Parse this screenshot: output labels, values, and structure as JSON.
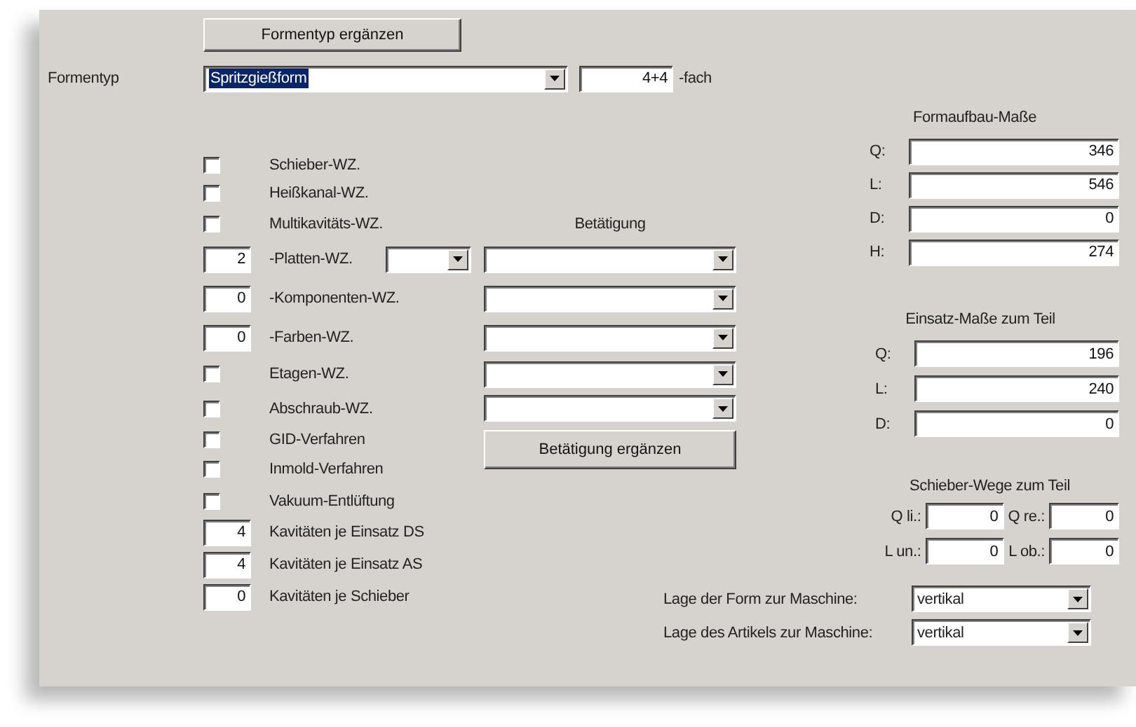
{
  "form_type_button": "Formentyp ergänzen",
  "form_type": {
    "label": "Formentyp",
    "value": "Spritzgießform",
    "highlighted": true,
    "multiplier": "4+4",
    "multiplier_suffix": "-fach"
  },
  "actuation_header": "Betätigung",
  "options": [
    {
      "kind": "checkbox",
      "label": "Schieber-WZ.",
      "checked": false,
      "actuation_select": false
    },
    {
      "kind": "checkbox",
      "label": "Heißkanal-WZ.",
      "checked": false,
      "actuation_select": false
    },
    {
      "kind": "checkbox",
      "label": "Multikavitäts-WZ.",
      "checked": false,
      "actuation_select": false
    },
    {
      "kind": "number_select",
      "value": "2",
      "label": "-Platten-WZ.",
      "actuation_select": true
    },
    {
      "kind": "number",
      "value": "0",
      "label": "-Komponenten-WZ.",
      "actuation_select": true
    },
    {
      "kind": "number",
      "value": "0",
      "label": "-Farben-WZ.",
      "actuation_select": true
    },
    {
      "kind": "checkbox",
      "label": "Etagen-WZ.",
      "checked": false,
      "actuation_select": true
    },
    {
      "kind": "checkbox",
      "label": "Abschraub-WZ.",
      "checked": false,
      "actuation_select": true
    },
    {
      "kind": "checkbox",
      "label": "GID-Verfahren",
      "checked": false,
      "actuation_select": false
    },
    {
      "kind": "checkbox",
      "label": "Inmold-Verfahren",
      "checked": false,
      "actuation_select": false
    },
    {
      "kind": "checkbox",
      "label": "Vakuum-Entlüftung",
      "checked": false,
      "actuation_select": false
    },
    {
      "kind": "number",
      "value": "4",
      "label": "Kavitäten je Einsatz DS",
      "actuation_select": false
    },
    {
      "kind": "number",
      "value": "4",
      "label": "Kavitäten je Einsatz AS",
      "actuation_select": false
    },
    {
      "kind": "number",
      "value": "0",
      "label": "Kavitäten je Schieber",
      "actuation_select": false
    }
  ],
  "actuation_button": "Betätigung ergänzen",
  "mold_dimensions": {
    "title": "Formaufbau-Maße",
    "fields": [
      {
        "label": "Q:",
        "value": "346"
      },
      {
        "label": "L:",
        "value": "546"
      },
      {
        "label": "D:",
        "value": "0"
      },
      {
        "label": "H:",
        "value": "274"
      }
    ]
  },
  "insert_dimensions": {
    "title": "Einsatz-Maße zum Teil",
    "fields": [
      {
        "label": "Q:",
        "value": "196"
      },
      {
        "label": "L:",
        "value": "240"
      },
      {
        "label": "D:",
        "value": "0"
      }
    ]
  },
  "slide_travel": {
    "title": "Schieber-Wege zum Teil",
    "fields": [
      {
        "label": "Q li.:",
        "value": "0"
      },
      {
        "label": "Q re.:",
        "value": "0"
      },
      {
        "label": "L un.:",
        "value": "0"
      },
      {
        "label": "L ob.:",
        "value": "0"
      }
    ]
  },
  "positions": [
    {
      "label": "Lage der Form zur Maschine:",
      "value": "vertikal"
    },
    {
      "label": "Lage des Artikels zur Maschine:",
      "value": "vertikal"
    }
  ]
}
